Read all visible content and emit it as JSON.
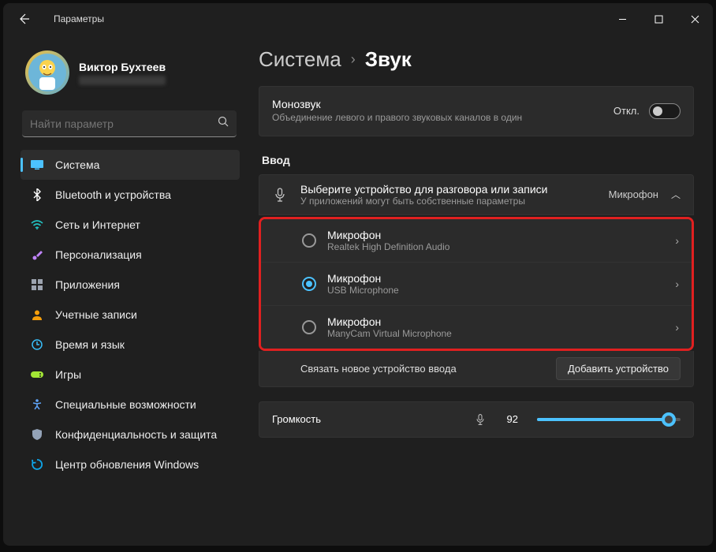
{
  "window": {
    "title": "Параметры"
  },
  "profile": {
    "name": "Виктор Бухтеев"
  },
  "search": {
    "placeholder": "Найти параметр"
  },
  "sidebar": {
    "items": [
      {
        "label": "Система",
        "icon": "system",
        "color": "#4cc2ff",
        "active": true
      },
      {
        "label": "Bluetooth и устройства",
        "icon": "bluetooth",
        "color": "#3b82f6"
      },
      {
        "label": "Сеть и Интернет",
        "icon": "wifi",
        "color": "#22c0c0"
      },
      {
        "label": "Персонализация",
        "icon": "brush",
        "color": "#c084fc"
      },
      {
        "label": "Приложения",
        "icon": "apps",
        "color": "#9ca3af"
      },
      {
        "label": "Учетные записи",
        "icon": "account",
        "color": "#f59e0b"
      },
      {
        "label": "Время и язык",
        "icon": "clock",
        "color": "#38bdf8"
      },
      {
        "label": "Игры",
        "icon": "games",
        "color": "#a3e635"
      },
      {
        "label": "Специальные возможности",
        "icon": "accessibility",
        "color": "#60a5fa"
      },
      {
        "label": "Конфиденциальность и защита",
        "icon": "shield",
        "color": "#94a3b8"
      },
      {
        "label": "Центр обновления Windows",
        "icon": "update",
        "color": "#0ea5e9"
      }
    ]
  },
  "breadcrumb": {
    "parent": "Система",
    "current": "Звук"
  },
  "mono": {
    "title": "Монозвук",
    "desc": "Объединение левого и правого звуковых каналов в один",
    "state_label": "Откл."
  },
  "input_section": {
    "label": "Ввод"
  },
  "input_header": {
    "title": "Выберите устройство для разговора или записи",
    "desc": "У приложений могут быть собственные параметры",
    "selected": "Микрофон"
  },
  "devices": [
    {
      "name": "Микрофон",
      "sub": "Realtek High Definition Audio",
      "selected": false
    },
    {
      "name": "Микрофон",
      "sub": "USB Microphone",
      "selected": true
    },
    {
      "name": "Микрофон",
      "sub": "ManyCam Virtual Microphone",
      "selected": false
    }
  ],
  "pair": {
    "label": "Связать новое устройство ввода",
    "button": "Добавить устройство"
  },
  "volume": {
    "label": "Громкость",
    "value": "92",
    "percent": 92
  }
}
